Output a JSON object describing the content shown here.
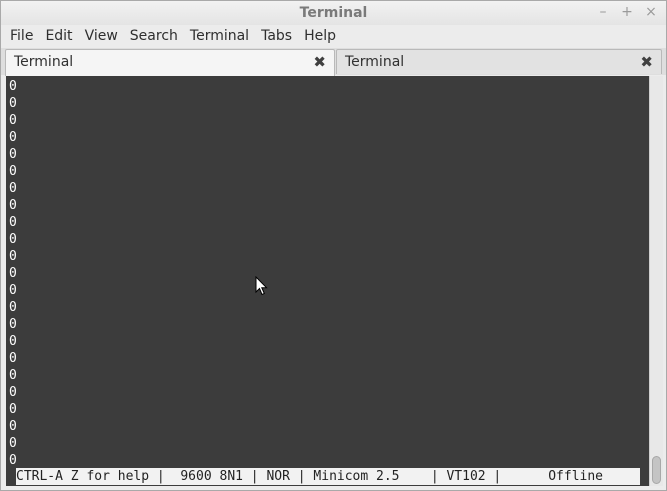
{
  "window": {
    "title": "Terminal",
    "minimize_glyph": "–",
    "maximize_glyph": "+",
    "close_glyph": "×"
  },
  "menu": [
    "File",
    "Edit",
    "View",
    "Search",
    "Terminal",
    "Tabs",
    "Help"
  ],
  "tabs": [
    {
      "label": "Terminal",
      "active": true,
      "close_glyph": "✖"
    },
    {
      "label": "Terminal",
      "active": false,
      "close_glyph": "✖"
    }
  ],
  "terminal": {
    "lines": [
      "0",
      "0",
      "0",
      "0",
      "0",
      "0",
      "0",
      "0",
      "0",
      "0",
      "0",
      "0",
      "0",
      "0",
      "0",
      "0",
      "0",
      "0",
      "0",
      "0",
      "0",
      "0",
      "0"
    ],
    "status_line": "CTRL-A Z for help |  9600 8N1 | NOR | Minicom 2.5    | VT102 |      Offline",
    "background": "#3c3c3c",
    "foreground": "#ffffff"
  },
  "icons": {
    "close_tab": "close-icon",
    "pointer": "mouse-pointer-icon"
  }
}
